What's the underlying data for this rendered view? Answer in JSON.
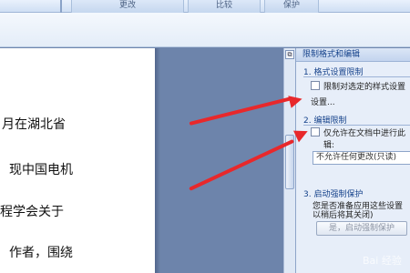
{
  "ribbon": {
    "groups": [
      "更改",
      "比较",
      "保护"
    ]
  },
  "document": {
    "lines": [
      "月在湖北省",
      "现中国电机",
      "程学会关于",
      "作者，围绕"
    ]
  },
  "task_pane": {
    "title": "限制格式和编辑",
    "sections": [
      {
        "title": "1. 格式设置限制",
        "checkbox_label": "限制对选定的样式设置",
        "checkbox_label_cont": "设置...",
        "checked": false
      },
      {
        "title": "2. 编辑限制",
        "checkbox_label": "仅允许在文档中进行此",
        "checkbox_label_cont": "辑:",
        "checked": false,
        "select_value": "不允许任何更改(只读)"
      },
      {
        "title": "3. 启动强制保护",
        "hint_line1": "您是否准备应用这些设置",
        "hint_line2": "以稍后将其关闭)",
        "button_label": "是，启动强制保护"
      }
    ]
  },
  "arrow_color": "#e8282b",
  "watermark": "Bai 经验"
}
